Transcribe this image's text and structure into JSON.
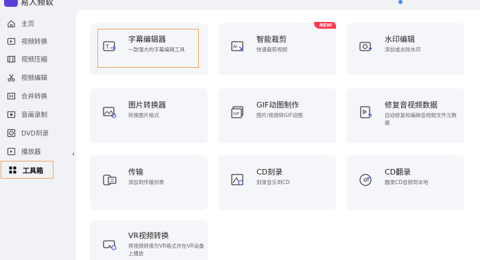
{
  "app": {
    "name": "易人频软"
  },
  "sidebar": {
    "items": [
      {
        "label": "主页",
        "icon": "home-icon"
      },
      {
        "label": "视频转换",
        "icon": "video-convert-icon"
      },
      {
        "label": "视频压缩",
        "icon": "video-compress-icon"
      },
      {
        "label": "视频编辑",
        "icon": "video-edit-icon"
      },
      {
        "label": "合并转换",
        "icon": "merge-icon"
      },
      {
        "label": "音画录制",
        "icon": "record-icon"
      },
      {
        "label": "DVD刻录",
        "icon": "dvd-icon"
      },
      {
        "label": "播放器",
        "icon": "player-icon"
      },
      {
        "label": "工具箱",
        "icon": "toolbox-icon",
        "active": true
      }
    ],
    "collapse_glyph": "‹"
  },
  "tools": [
    {
      "title": "字幕编辑器",
      "desc": "一款强大的字幕编辑工具",
      "icon": "subtitle-editor-icon",
      "highlighted": true
    },
    {
      "title": "智能裁剪",
      "desc": "快速裁剪视频",
      "icon": "smart-crop-icon",
      "badge": "NEW"
    },
    {
      "title": "水印编辑",
      "desc": "添加或去除水印",
      "icon": "watermark-icon"
    },
    {
      "title": "图片转换器",
      "desc": "转换图片格式",
      "icon": "image-convert-icon"
    },
    {
      "title": "GIF动图制作",
      "desc": "图片/视频转GIF动图",
      "icon": "gif-icon"
    },
    {
      "title": "修复音视频数据",
      "desc": "自动修复和编辑音视频文件元数据",
      "icon": "metadata-repair-icon"
    },
    {
      "title": "传输",
      "desc": "添加到传输列表",
      "icon": "transfer-icon"
    },
    {
      "title": "CD刻录",
      "desc": "刻录音乐到CD",
      "icon": "cd-burn-icon"
    },
    {
      "title": "CD翻录",
      "desc": "翻录CD音频到本地",
      "icon": "cd-rip-icon"
    },
    {
      "title": "VR视频转换",
      "desc": "将视频转换为VR格式并在VR设备上播放",
      "icon": "vr-convert-icon"
    }
  ],
  "colors": {
    "highlight": "#f0a35a",
    "badge": "#ff3b4e",
    "card_bg": "#f5f6f9"
  }
}
